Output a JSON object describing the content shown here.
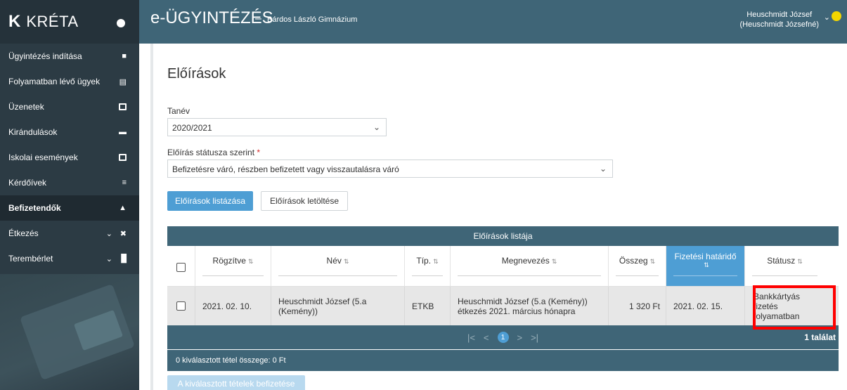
{
  "brand": {
    "logo": "K",
    "name": "KRÉTA"
  },
  "topbar": {
    "app_title": "e-ÜGYINTÉZÉS",
    "separator": "–",
    "school": "Bárdos László Gimnázium",
    "user_line1": "Heuschmidt József",
    "user_line2": "(Heuschmidt Józsefné)"
  },
  "sidebar": {
    "items": [
      {
        "label": "Ügyintézés indítása",
        "icon": "new-case-icon"
      },
      {
        "label": "Folyamatban lévő ügyek",
        "icon": "list-icon"
      },
      {
        "label": "Üzenetek",
        "icon": "envelope-icon"
      },
      {
        "label": "Kirándulások",
        "icon": "bed-icon"
      },
      {
        "label": "Iskolai események",
        "icon": "calendar-icon"
      },
      {
        "label": "Kérdőívek",
        "icon": "menu-icon"
      },
      {
        "label": "Befizetendők",
        "icon": "payment-icon",
        "active": true
      },
      {
        "label": "Étkezés",
        "icon": "cutlery-icon",
        "expandable": true
      },
      {
        "label": "Terembérlet",
        "icon": "door-icon",
        "expandable": true
      }
    ]
  },
  "page": {
    "title": "Előírások",
    "tanev_label": "Tanév",
    "tanev_value": "2020/2021",
    "status_label": "Előírás státusza szerint",
    "required_mark": "*",
    "status_value": "Befizetésre váró, részben befizetett vagy visszautalásra váró",
    "list_button": "Előírások listázása",
    "download_button": "Előírások letöltése",
    "pay_button": "A kiválasztott tételek befizetése"
  },
  "grid": {
    "title": "Előírások listája",
    "columns": [
      "Rögzítve",
      "Név",
      "Típ.",
      "Megnevezés",
      "Összeg",
      "Fizetési határidő",
      "Státusz"
    ],
    "sort_glyph": "⇅",
    "rows": [
      {
        "rogzitve": "2021. 02. 10.",
        "nev": "Heuschmidt József (5.a (Kemény))",
        "tip": "ETKB",
        "megnevezes": "Heuschmidt József (5.a (Kemény)) étkezés 2021. március hónapra",
        "osszeg": "1 320 Ft",
        "hatarido": "2021. 02. 15.",
        "statusz": "Bankkártyás fizetés folyamatban"
      }
    ],
    "pager": {
      "first": "|<",
      "prev": "<",
      "current": "1",
      "next": ">",
      "last": ">|"
    },
    "total": "1 találat",
    "summary": "0 kiválasztott tétel összege: 0 Ft"
  },
  "colors": {
    "sidebar": "#2c3b44",
    "topbar": "#3f6577",
    "primary": "#4e9ed4",
    "highlight": "#ff0000"
  }
}
